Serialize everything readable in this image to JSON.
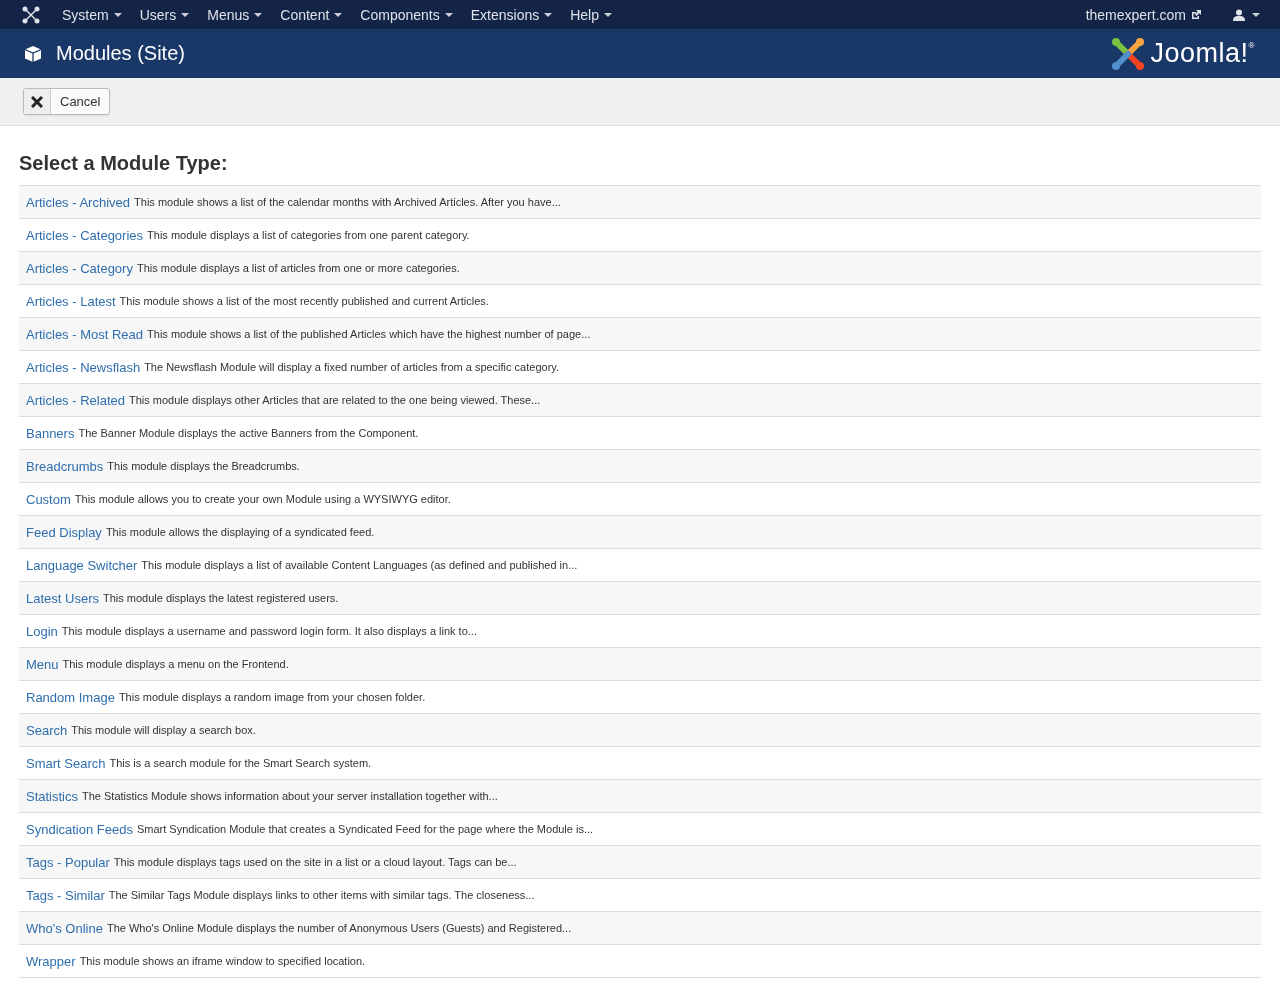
{
  "menu_bar": {
    "items": [
      "System",
      "Users",
      "Menus",
      "Content",
      "Components",
      "Extensions",
      "Help"
    ],
    "site_link": "themexpert.com"
  },
  "header": {
    "title": "Modules (Site)",
    "logo_text": "Joomla!$^{®}$"
  },
  "toolbar": {
    "buttons": [
      "Cancel"
    ]
  },
  "heading": "Select a Module Type:",
  "modules": [
    {
      "name": "Articles - Archived",
      "description": "This module shows a list of the calendar months with Archived Articles. After you have..."
    },
    {
      "name": "Articles - Categories",
      "description": "This module displays a list of categories from one parent category."
    },
    {
      "name": "Articles - Category",
      "description": "This module displays a list of articles from one or more categories."
    },
    {
      "name": "Articles - Latest",
      "description": "This module shows a list of the most recently published and current Articles."
    },
    {
      "name": "Articles - Most Read",
      "description": "This module shows a list of the published Articles which have the highest number of page..."
    },
    {
      "name": "Articles - Newsflash",
      "description": "The Newsflash Module will display a fixed number of articles from a specific category."
    },
    {
      "name": "Articles - Related",
      "description": "This module displays other Articles that are related to the one being viewed. These..."
    },
    {
      "name": "Banners",
      "description": "The Banner Module displays the active Banners from the Component."
    },
    {
      "name": "Breadcrumbs",
      "description": "This module displays the Breadcrumbs."
    },
    {
      "name": "Custom",
      "description": "This module allows you to create your own Module using a WYSIWYG editor."
    },
    {
      "name": "Feed Display",
      "description": "This module allows the displaying of a syndicated feed."
    },
    {
      "name": "Language Switcher",
      "description": "This module displays a list of available Content Languages (as defined and published in..."
    },
    {
      "name": "Latest Users",
      "description": "This module displays the latest registered users."
    },
    {
      "name": "Login",
      "description": "This module displays a username and password login form. It also displays a link to..."
    },
    {
      "name": "Menu",
      "description": "This module displays a menu on the Frontend."
    },
    {
      "name": "Random Image",
      "description": "This module displays a random image from your chosen folder."
    },
    {
      "name": "Search",
      "description": "This module will display a search box."
    },
    {
      "name": "Smart Search",
      "description": "This is a search module for the Smart Search system."
    },
    {
      "name": "Statistics",
      "description": "The Statistics Module shows information about your server installation together with..."
    },
    {
      "name": "Syndication Feeds",
      "description": "Smart Syndication Module that creates a Syndicated Feed for the page where the Module is..."
    },
    {
      "name": "Tags - Popular",
      "description": "This module displays tags used on the site in a list or a cloud layout. Tags can be..."
    },
    {
      "name": "Tags - Similar",
      "description": "The Similar Tags Module displays links to other items with similar tags. The closeness..."
    },
    {
      "name": "Who's Online",
      "description": "The Who's Online Module displays the number of Anonymous Users (Guests) and Registered..."
    },
    {
      "name": "Wrapper",
      "description": "This module shows an iframe window to specified location."
    }
  ]
}
